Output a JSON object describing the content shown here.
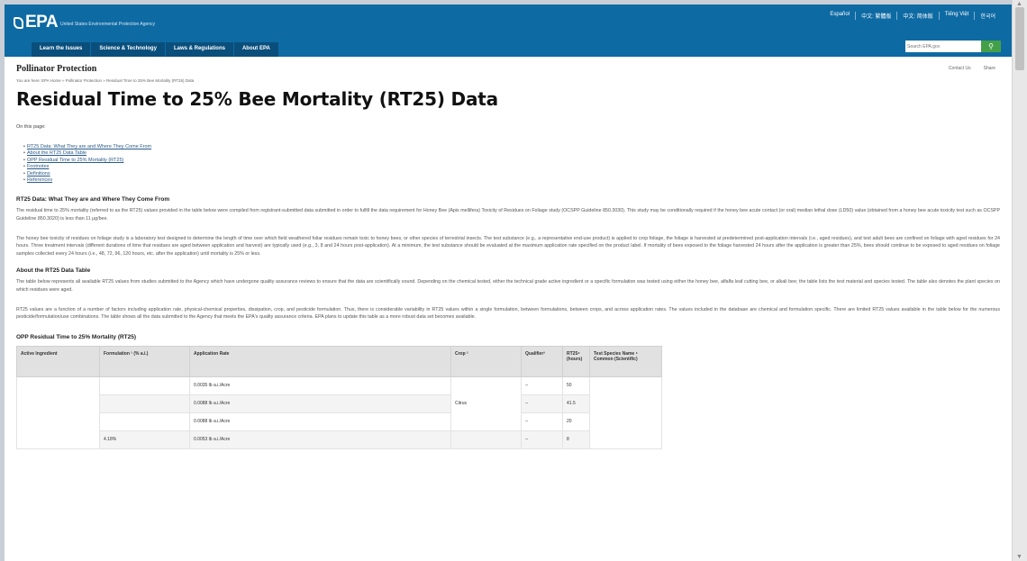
{
  "header": {
    "logo": "EPA",
    "logo_sub": "United States Environmental Protection Agency",
    "languages": [
      "Español",
      "中文: 繁體版",
      "中文: 简体版",
      "Tiếng Việt",
      "한국어"
    ],
    "nav": [
      "Learn the Issues",
      "Science & Technology",
      "Laws & Regulations",
      "About EPA"
    ],
    "search_placeholder": "Search EPA.gov",
    "search_button": "⚲"
  },
  "page": {
    "section_name": "Pollinator Protection",
    "contact": "Contact Us",
    "share": "Share",
    "breadcrumb": "You are here: EPA Home » Pollinator Protection » Residual Time to 25% Bee Mortality (RT25) Data",
    "title": "Residual Time to 25% Bee Mortality (RT25) Data",
    "on_this_page": "On this page:",
    "toc": [
      "RT25 Data: What They are and Where They Come From",
      "About the RT25 Data Table",
      "OPP Residual Time to 25% Mortality (RT25)",
      "Footnotes",
      "Definitions",
      "References"
    ]
  },
  "section1": {
    "heading": "RT25 Data: What They are and Where They Come From",
    "p1": "The residual time to 25% mortality (referred to as the RT25) values provided in the table below were compiled from registrant-submitted data submitted in order to fulfill the data requirement for Honey Bee (Apis mellifera) Toxicity of Residues on Foliage study (OCSPP Guideline 850.3030). This study may be conditionally required if the honey bee acute contact (or oral) median lethal dose (LD50) value (obtained from a honey bee acute toxicity test such as OCSPP Guideline 850.3020) is less than 11 µg/bee.",
    "p2": "The honey bee toxicity of residues on foliage study is a laboratory test designed to determine the length of time over which field weathered foliar residues remain toxic to honey bees, or other species of terrestrial insects. The test substance (e.g., a representative end-use product) is applied to crop foliage, the foliage is harvested at predetermined post-application intervals (i.e., aged residues), and test adult bees are confined on foliage with aged residues for 24 hours. Three treatment intervals (different durations of time that residues are aged between application and harvest) are typically used (e.g., 3, 8 and 24 hours post-application). At a minimum, the test substance should be evaluated at the maximum application rate specified on the product label. If mortality of bees exposed to the foliage harvested 24 hours after the application is greater than 25%, bees should continue to be exposed to aged residues on foliage samples collected every 24 hours (i.e., 48, 72, 96, 120 hours, etc. after the application) until mortality is 25% or less."
  },
  "section2": {
    "heading": "About the RT25 Data Table",
    "p1": "The table below represents all available RT25 values from studies submitted to the Agency which have undergone quality assurance reviews to ensure that the data are scientifically sound. Depending on the chemical tested, either the technical grade active ingredient or a specific formulation was tested using either the honey bee, alfalfa leaf cutting bee, or alkali bee; the table lists the test material and species tested. The table also denotes the plant species on which residues were aged.",
    "p2": "RT25 values are a function of a number of factors including application rate, physical-chemical properties, dissipation, crop, and pesticide formulation. Thus, there is considerable variability in RT25 values within a single formulation, between formulations, between crops, and across application rates. The values included in the database are chemical and formulation specific. There are limited RT25 values available in the table below for the numerous pesticide/formulation/use combinations. The table shows all the data submitted to the Agency that meets the EPA's quality assurance criteria. EPA plans to update this table as a more robust data set becomes available."
  },
  "table": {
    "caption": "OPP Residual Time to 25% Mortality (RT25)",
    "headers": [
      "Active Ingredient",
      "Formulation ¹ (% a.i.)",
      "Application Rate",
      "Crop ²",
      "Qualifier³",
      "RT25⁴ (hours)",
      "Test Species Name ⁵ Common (Scientific)"
    ],
    "rows": [
      {
        "rate": "0.0035 lb a.i./Acre",
        "qual": "--",
        "rt": "50"
      },
      {
        "rate": "0.0088 lb a.i./Acre",
        "qual": "--",
        "rt": "41.5"
      },
      {
        "rate": "0.0088 lb a.i./Acre",
        "qual": "--",
        "rt": "20"
      },
      {
        "rate": "0.0053 lb a.i./Acre",
        "qual": "--",
        "rt": "8"
      }
    ],
    "crop": "Citrus",
    "formulation": "4.18%"
  }
}
